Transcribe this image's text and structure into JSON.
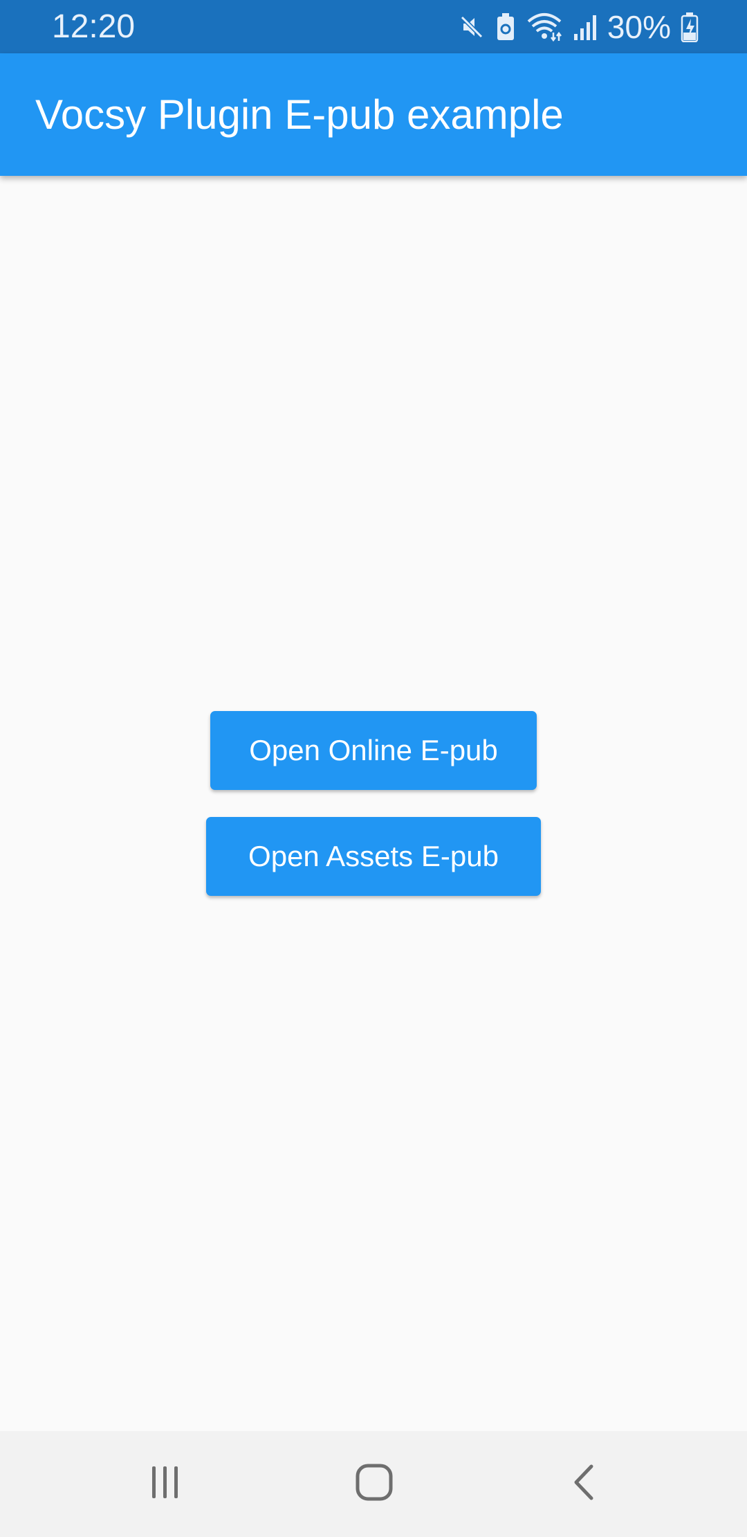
{
  "status_bar": {
    "time": "12:20",
    "battery_percent": "30%",
    "icons": [
      "mute-icon",
      "battery-saver-icon",
      "wifi-icon",
      "signal-icon",
      "battery-charging-icon"
    ]
  },
  "app_bar": {
    "title": "Vocsy Plugin E-pub example"
  },
  "main": {
    "buttons": [
      {
        "label": "Open Online E-pub"
      },
      {
        "label": "Open Assets E-pub"
      }
    ]
  },
  "nav_bar": {
    "items": [
      "recents-icon",
      "home-icon",
      "back-icon"
    ]
  },
  "colors": {
    "status_bar": "#1a71bd",
    "primary": "#2196f3",
    "background": "#fafafa",
    "nav_bar": "#f2f2f2"
  }
}
